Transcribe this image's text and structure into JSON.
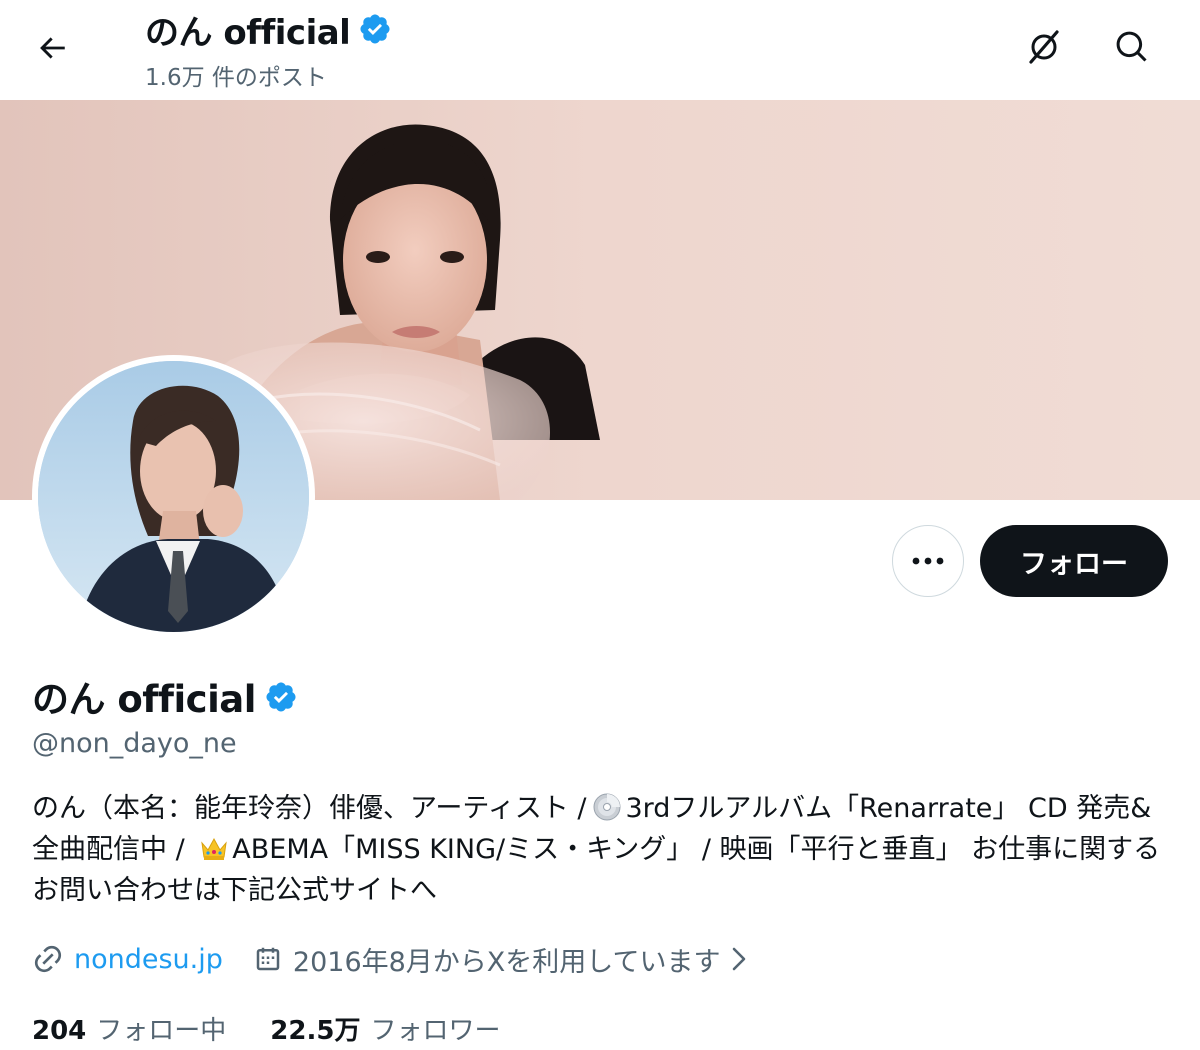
{
  "header": {
    "title": "のん official",
    "post_count": "1.6万 件のポスト"
  },
  "icons": {
    "back": "arrow-left-icon",
    "grok": "grok-icon",
    "search": "search-icon",
    "verified": "verified-badge-icon",
    "more": "more-dots-icon",
    "link": "link-icon",
    "calendar": "calendar-icon",
    "chevron": "chevron-right-icon"
  },
  "actions": {
    "follow_label": "フォロー"
  },
  "profile": {
    "display_name": "のん official",
    "handle": "@non_dayo_ne",
    "bio": {
      "part1": "のん（本名：能年玲奈）俳優、アーティスト /",
      "emoji1": "💿",
      "part2": "3rdフルアルバム「Renarrate」 CD 発売&全曲配信中 /",
      "emoji2": "👑",
      "part3": "ABEMA「MISS KING/ミス・キング」 / 映画「平行と垂直」 お仕事に関するお問い合わせは下記公式サイトへ"
    },
    "website": "nondesu.jp",
    "joined": "2016年8月からXを利用しています"
  },
  "stats": {
    "following_count": "204",
    "following_label": "フォロー中",
    "followers_count": "22.5万",
    "followers_label": "フォロワー"
  },
  "colors": {
    "accent": "#1d9bf0",
    "text_primary": "#0f1419",
    "text_secondary": "#536471",
    "button_dark": "#0f1419",
    "banner_bg": "#e8cfc6",
    "avatar_sky": "#b9d6ec"
  }
}
